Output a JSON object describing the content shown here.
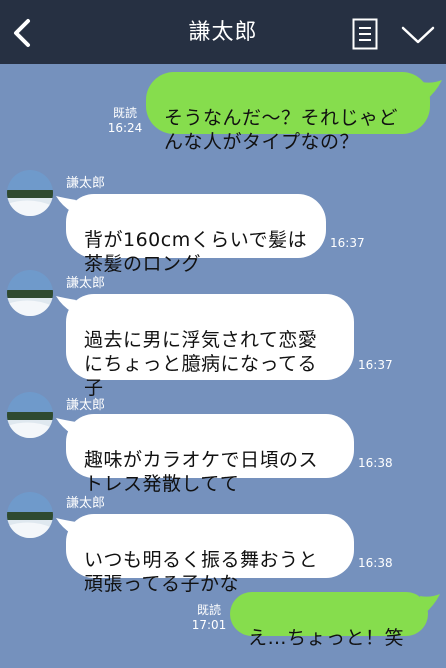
{
  "header": {
    "title": "謙太郎",
    "back_icon": "chevron-left-icon",
    "memo_icon": "memo-icon",
    "menu_icon": "chevron-down-icon"
  },
  "colors": {
    "background": "#7591bd",
    "header": "#263042",
    "outgoing_bubble": "#86dd4d",
    "incoming_bubble": "#ffffff"
  },
  "messages": [
    {
      "direction": "out",
      "text": "そうなんだ～？それじゃど\nんな人がタイプなの？",
      "read": "既読",
      "time": "16:24"
    },
    {
      "direction": "in",
      "sender": "謙太郎",
      "text": "背が160cmくらいで髪は\n茶髪のロング",
      "time": "16:37"
    },
    {
      "direction": "in",
      "sender": "謙太郎",
      "text": "過去に男に浮気されて恋愛\nにちょっと臆病になってる\n子",
      "time": "16:37"
    },
    {
      "direction": "in",
      "sender": "謙太郎",
      "text": "趣味がカラオケで日頃のス\nトレス発散してて",
      "time": "16:38"
    },
    {
      "direction": "in",
      "sender": "謙太郎",
      "text": "いつも明るく振る舞おうと\n頑張ってる子かな",
      "time": "16:38"
    },
    {
      "direction": "out",
      "text": "え…ちょっと！笑",
      "read": "既読",
      "time": "17:01"
    }
  ]
}
